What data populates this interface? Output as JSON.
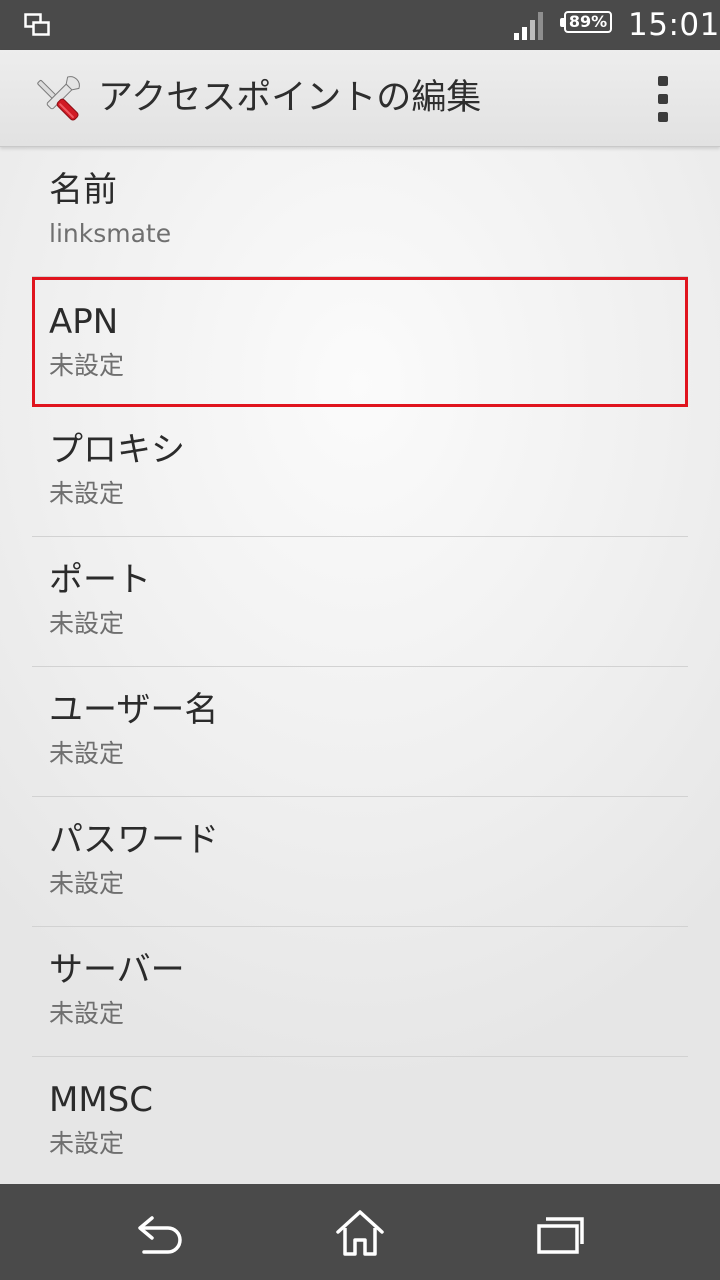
{
  "status_bar": {
    "battery_percent": "89%",
    "time": "15:01",
    "left_icon": "screen-mirroring-icon",
    "signal_icon": "cell-signal-icon",
    "battery_icon": "battery-icon"
  },
  "action_bar": {
    "title": "アクセスポイントの編集",
    "app_icon": "tools-icon",
    "menu_icon": "overflow-menu-icon"
  },
  "settings": {
    "items": [
      {
        "title": "名前",
        "value": "linksmate"
      },
      {
        "title": "APN",
        "value": "未設定"
      },
      {
        "title": "プロキシ",
        "value": "未設定"
      },
      {
        "title": "ポート",
        "value": "未設定"
      },
      {
        "title": "ユーザー名",
        "value": "未設定"
      },
      {
        "title": "パスワード",
        "value": "未設定"
      },
      {
        "title": "サーバー",
        "value": "未設定"
      },
      {
        "title": "MMSC",
        "value": "未設定"
      }
    ]
  },
  "nav_bar": {
    "back_icon": "back-icon",
    "home_icon": "home-icon",
    "recents_icon": "recent-apps-icon"
  },
  "colors": {
    "status_bar_bg": "#4a4a4a",
    "highlight_border": "#e0141e",
    "tool_handle": "#d01a24"
  }
}
